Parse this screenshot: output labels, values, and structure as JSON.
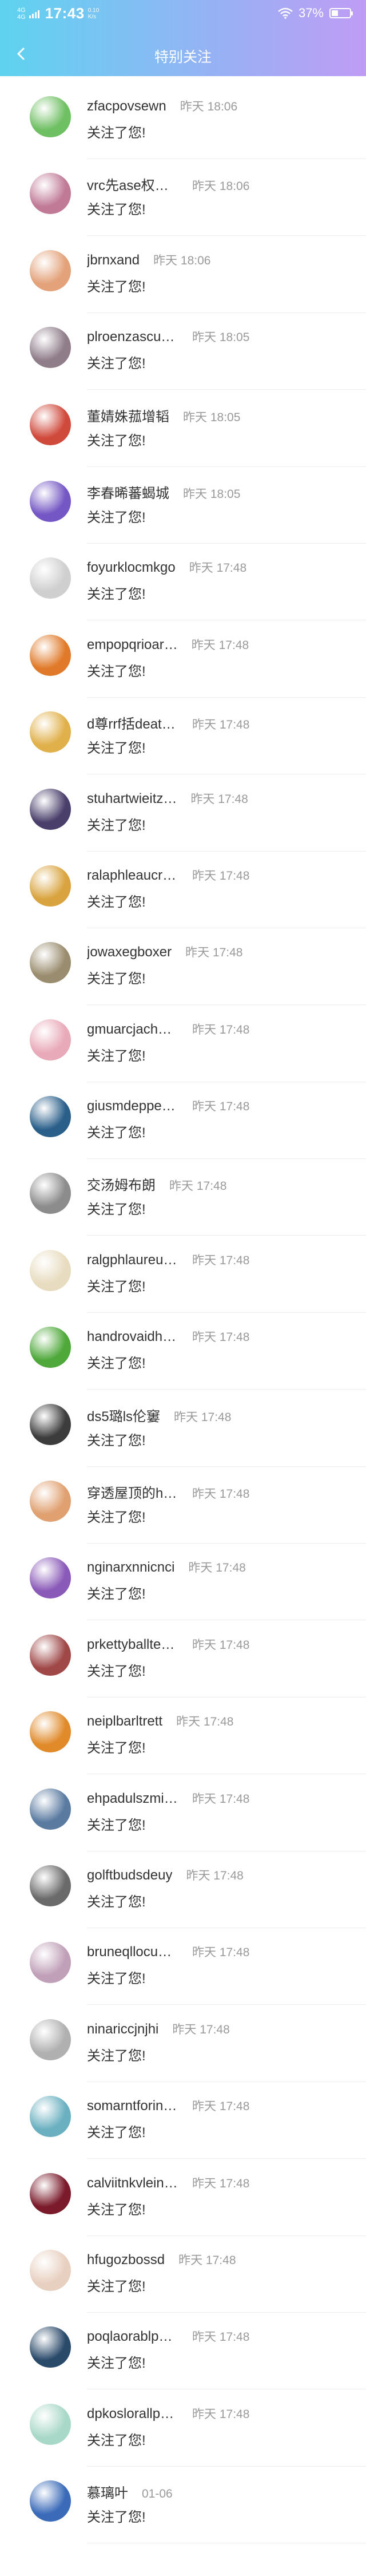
{
  "status_bar": {
    "signal_text_1": "4G",
    "signal_text_2": "4G",
    "time": "17:43",
    "speed_value": "0.10",
    "speed_unit": "K/s",
    "battery_percent": "37%",
    "battery_level": 0.37,
    "icons": [
      "signal-icon",
      "wifi-icon",
      "battery-icon"
    ]
  },
  "nav": {
    "title": "特别关注",
    "back_icon": "chevron-left-icon"
  },
  "follow_list": [
    {
      "name": "zfacpovsewn",
      "time": "昨天 18:06",
      "message": "关注了您!",
      "color": "#6fbf63"
    },
    {
      "name": "vrc先ase权智…",
      "time": "昨天 18:06",
      "message": "关注了您!",
      "color": "#c07a96"
    },
    {
      "name": "jbrnxand",
      "time": "昨天 18:06",
      "message": "关注了您!",
      "color": "#e3a27a"
    },
    {
      "name": "plroenzascuh…",
      "time": "昨天 18:05",
      "message": "关注了您!",
      "color": "#8f7d8a"
    },
    {
      "name": "董婧姝菰增韬",
      "time": "昨天 18:05",
      "message": "关注了您!",
      "color": "#d04a3c"
    },
    {
      "name": "李春晞蕃蝎城",
      "time": "昨天 18:05",
      "message": "关注了您!",
      "color": "#7457c4"
    },
    {
      "name": "foyurklocmkgo",
      "time": "昨天 17:48",
      "message": "关注了您!",
      "color": "#cfcfcf"
    },
    {
      "name": "empopqrioar…",
      "time": "昨天 17:48",
      "message": "关注了您!",
      "color": "#e07a2a"
    },
    {
      "name": "d尊rrf括death…",
      "time": "昨天 17:48",
      "message": "关注了您!",
      "color": "#e0b04a"
    },
    {
      "name": "stuhartwieitz…",
      "time": "昨天 17:48",
      "message": "关注了您!",
      "color": "#4a3f6b"
    },
    {
      "name": "ralaphleaucrren",
      "time": "昨天 17:48",
      "message": "关注了您!",
      "color": "#d9a440"
    },
    {
      "name": "jowaxegboxer",
      "time": "昨天 17:48",
      "message": "关注了您!",
      "color": "#9a8c6e"
    },
    {
      "name": "gmuarcjachobs",
      "time": "昨天 17:48",
      "message": "关注了您!",
      "color": "#e8a9b8"
    },
    {
      "name": "giusmdeppek…",
      "time": "昨天 17:48",
      "message": "关注了您!",
      "color": "#2a5f8a"
    },
    {
      "name": "交汤姆布朗",
      "time": "昨天 17:48",
      "message": "关注了您!",
      "color": "#8c8c8c"
    },
    {
      "name": "ralgphlaureuna",
      "time": "昨天 17:48",
      "message": "关注了您!",
      "color": "#e8dcc0"
    },
    {
      "name": "handrovaidho…",
      "time": "昨天 17:48",
      "message": "关注了您!",
      "color": "#4ea83a"
    },
    {
      "name": "ds5璐ls伦窶",
      "time": "昨天 17:48",
      "message": "关注了您!",
      "color": "#3c3c3c"
    },
    {
      "name": "穿透屋顶的hi…",
      "time": "昨天 17:48",
      "message": "关注了您!",
      "color": "#e0a070"
    },
    {
      "name": "nginarxnnicnci",
      "time": "昨天 17:48",
      "message": "关注了您!",
      "color": "#8a5ab8"
    },
    {
      "name": "prkettyballteri…",
      "time": "昨天 17:48",
      "message": "关注了您!",
      "color": "#a04848"
    },
    {
      "name": "neiplbarltrett",
      "time": "昨天 17:48",
      "message": "关注了您!",
      "color": "#e08a2a"
    },
    {
      "name": "ehpadulszmitph",
      "time": "昨天 17:48",
      "message": "关注了您!",
      "color": "#5a7aa0"
    },
    {
      "name": "golftbudsdeuy",
      "time": "昨天 17:48",
      "message": "关注了您!",
      "color": "#6a6a6a"
    },
    {
      "name": "bruneqllocuci…",
      "time": "昨天 17:48",
      "message": "关注了您!",
      "color": "#c0a0b8"
    },
    {
      "name": "ninariccjnjhi",
      "time": "昨天 17:48",
      "message": "关注了您!",
      "color": "#b0b0b0"
    },
    {
      "name": "somarntforintwo",
      "time": "昨天 17:48",
      "message": "关注了您!",
      "color": "#6ab0c0"
    },
    {
      "name": "calviitnkvleinj…",
      "time": "昨天 17:48",
      "message": "关注了您!",
      "color": "#7a1a2a"
    },
    {
      "name": "hfugozbossd",
      "time": "昨天 17:48",
      "message": "关注了您!",
      "color": "#e8d0c0"
    },
    {
      "name": "poqlaorablphl…",
      "time": "昨天 17:48",
      "message": "关注了您!",
      "color": "#2a4a6a"
    },
    {
      "name": "dpkoslorallphl…",
      "time": "昨天 17:48",
      "message": "关注了您!",
      "color": "#a8d8c8"
    },
    {
      "name": "慕璃叶",
      "time": "01-06",
      "message": "关注了您!",
      "color": "#3a6ab8"
    }
  ]
}
